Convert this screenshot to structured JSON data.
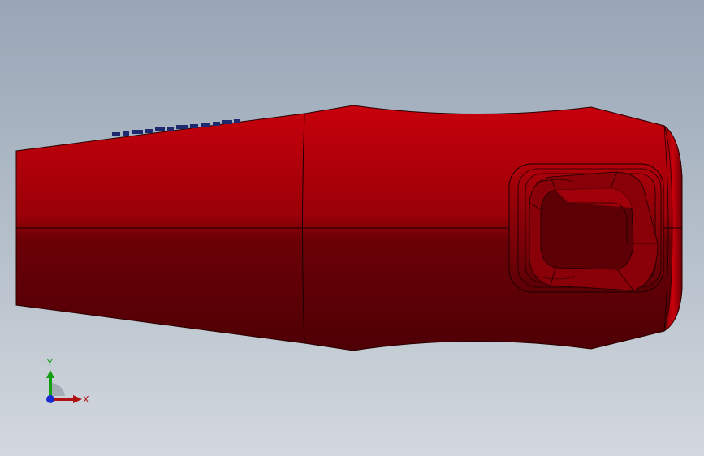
{
  "viewport": {
    "background_top": "#98a6b6",
    "background_bottom": "#d3d8de"
  },
  "model": {
    "part_color": "#c0000a",
    "part_shadow": "#5a0006",
    "edge_color": "#1a0000",
    "text_pattern_color": "#1e2a70"
  },
  "triad": {
    "x_label": "X",
    "y_label": "Y",
    "x_color": "#b01010",
    "y_color": "#10a010",
    "z_color": "#1a2ad0"
  }
}
